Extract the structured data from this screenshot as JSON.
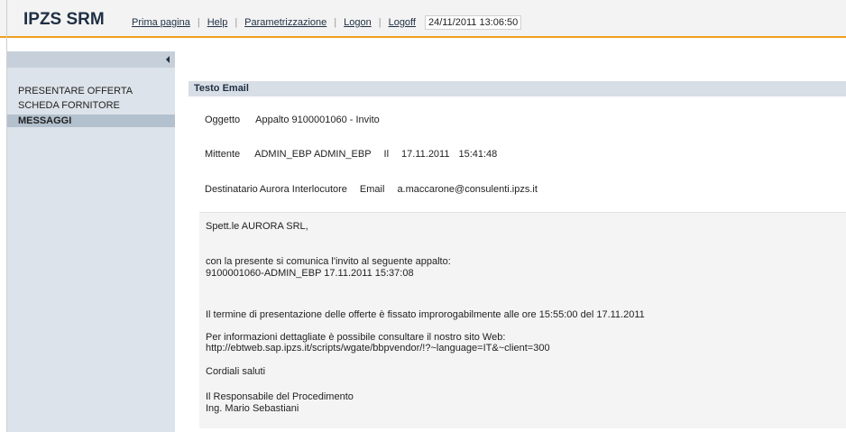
{
  "header": {
    "app_title": "IPZS SRM",
    "nav": [
      "Prima pagina",
      "Help",
      "Parametrizzazione",
      "Logon",
      "Logoff"
    ],
    "datetime": "24/11/2011 13:06:50"
  },
  "sidebar": {
    "items": [
      {
        "label": "PRESENTARE OFFERTA",
        "active": false
      },
      {
        "label": "SCHEDA FORNITORE",
        "active": false
      },
      {
        "label": "MESSAGGI",
        "active": true
      }
    ]
  },
  "email": {
    "section_title": "Testo Email",
    "oggetto_label": "Oggetto",
    "oggetto_value": "Appalto 9100001060 - Invito",
    "mittente_label": "Mittente",
    "mittente_value": "ADMIN_EBP ADMIN_EBP",
    "il_label": "Il",
    "date_value": "17.11.2011",
    "time_value": "15:41:48",
    "destinatario_label": "Destinatario",
    "destinatario_value": "Aurora Interlocutore",
    "email_label": "Email",
    "email_value": "a.maccarone@consulenti.ipzs.it",
    "body": [
      "Spett.le AURORA SRL,",
      "con la presente si comunica l'invito al seguente appalto:",
      "9100001060-ADMIN_EBP 17.11.2011 15:37:08",
      "Il termine di presentazione delle offerte è fissato improrogabilmente alle ore 15:55:00 del 17.11.2011",
      "Per informazioni dettagliate è possibile consultare il nostro sito Web:",
      "http://ebtweb.sap.ipzs.it/scripts/wgate/bbpvendor/!?~language=IT&~client=300",
      "Cordiali saluti",
      "Il Responsabile del Procedimento",
      "Ing. Mario Sebastiani"
    ]
  },
  "colors": {
    "accent": "#f0a020",
    "brand": "#1f2f44",
    "sidebar_bg": "#dde3ea",
    "sidebar_active": "#b3c0cd"
  }
}
